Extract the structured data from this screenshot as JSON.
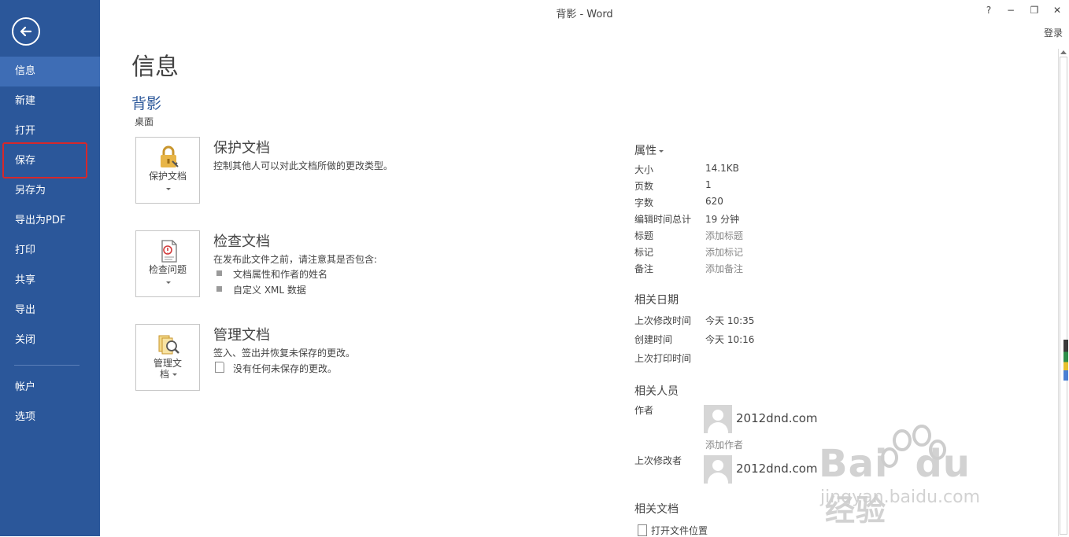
{
  "window": {
    "title": "背影 - Word",
    "help": "?",
    "minimize": "−",
    "restore": "❐",
    "close": "✕",
    "signin": "登录"
  },
  "sidebar": {
    "back_icon": "back-arrow-icon",
    "items": [
      {
        "label": "信息"
      },
      {
        "label": "新建"
      },
      {
        "label": "打开"
      },
      {
        "label": "保存"
      },
      {
        "label": "另存为"
      },
      {
        "label": "导出为PDF"
      },
      {
        "label": "打印"
      },
      {
        "label": "共享"
      },
      {
        "label": "导出"
      },
      {
        "label": "关闭"
      },
      {
        "label": "帐户"
      },
      {
        "label": "选项"
      }
    ],
    "active_color": "#3e6db5",
    "bg_color": "#2b579a",
    "highlight_color": "#d6282b"
  },
  "main": {
    "title": "信息",
    "doc_name": "背影",
    "doc_location": "桌面",
    "sections": [
      {
        "tile_label": "保护文档",
        "tile_icon": "lock-icon",
        "title": "保护文档",
        "desc": "控制其他人可以对此文档所做的更改类型。"
      },
      {
        "tile_label": "检查问题",
        "tile_icon": "inspect-document-icon",
        "title": "检查文档",
        "desc": "在发布此文件之前，请注意其是否包含:",
        "bullets": [
          "文档属性和作者的姓名",
          "自定义 XML 数据"
        ]
      },
      {
        "tile_label_line1": "管理文",
        "tile_label_line2": "档",
        "tile_icon": "manage-versions-icon",
        "title": "管理文档",
        "desc": "签入、签出并恢复未保存的更改。",
        "note": "没有任何未保存的更改。"
      }
    ]
  },
  "properties": {
    "heading": "属性",
    "rows": [
      {
        "label": "大小",
        "value": "14.1KB"
      },
      {
        "label": "页数",
        "value": "1"
      },
      {
        "label": "字数",
        "value": "620"
      },
      {
        "label": "编辑时间总计",
        "value": "19 分钟"
      },
      {
        "label": "标题",
        "value": "添加标题"
      },
      {
        "label": "标记",
        "value": "添加标记"
      },
      {
        "label": "备注",
        "value": "添加备注"
      }
    ],
    "dates_heading": "相关日期",
    "dates": [
      {
        "label": "上次修改时间",
        "value": "今天 10:35"
      },
      {
        "label": "创建时间",
        "value": "今天 10:16"
      },
      {
        "label": "上次打印时间",
        "value": ""
      }
    ],
    "people_heading": "相关人员",
    "author_label": "作者",
    "author_name": "2012dnd.com",
    "add_author": "添加作者",
    "last_modified_by_label": "上次修改者",
    "last_modified_by_name": "2012dnd.com",
    "related_docs_heading": "相关文档",
    "open_location": "打开文件位置"
  },
  "watermark": {
    "brand": "Bai",
    "brand2": "du",
    "brand_cn": "经验",
    "url": "jingyan.baidu.com"
  }
}
